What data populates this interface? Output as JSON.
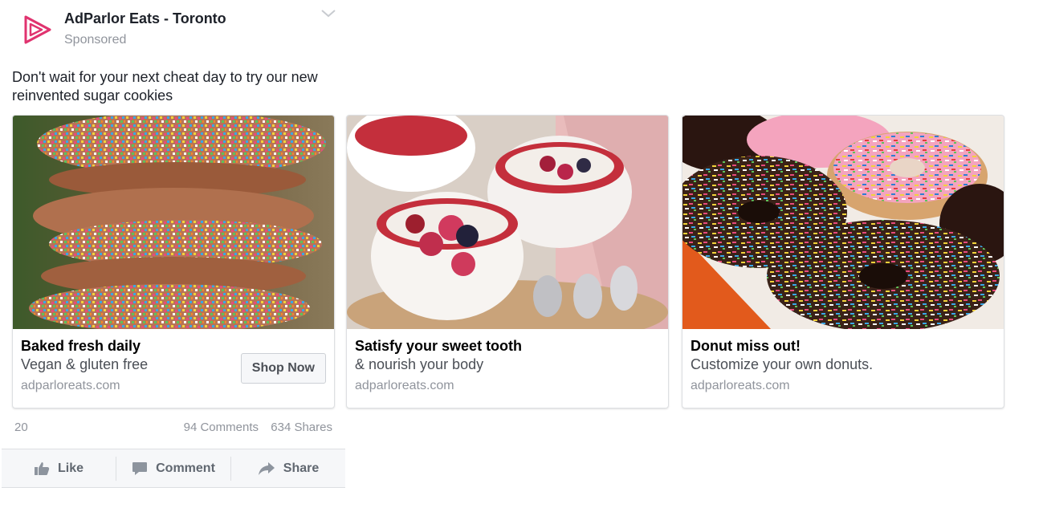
{
  "post": {
    "page_name": "AdParlor Eats - Toronto",
    "sponsored_label": "Sponsored",
    "text": "Don't wait for your next cheat day to try our new reinvented sugar cookies",
    "brand_color": "#e0336f"
  },
  "cards": [
    {
      "image": "sprinkle-cookies-photo",
      "title": "Baked fresh daily",
      "description": "Vegan & gluten free",
      "domain": "adparloreats.com",
      "cta_label": "Shop Now"
    },
    {
      "image": "berry-yogurt-bowls-photo",
      "title": "Satisfy your sweet tooth",
      "description": "& nourish your body",
      "domain": "adparloreats.com"
    },
    {
      "image": "sprinkle-donuts-photo",
      "title": "Donut miss out!",
      "description": "Customize your own donuts.",
      "domain": "adparloreats.com"
    }
  ],
  "stats": {
    "reactions": "20",
    "comments": "94 Comments",
    "shares": "634 Shares"
  },
  "actions": {
    "like": "Like",
    "comment": "Comment",
    "share": "Share"
  },
  "icons": [
    "play-logo-icon",
    "chevron-down-icon",
    "thumbs-up-icon",
    "comment-icon",
    "share-arrow-icon"
  ]
}
